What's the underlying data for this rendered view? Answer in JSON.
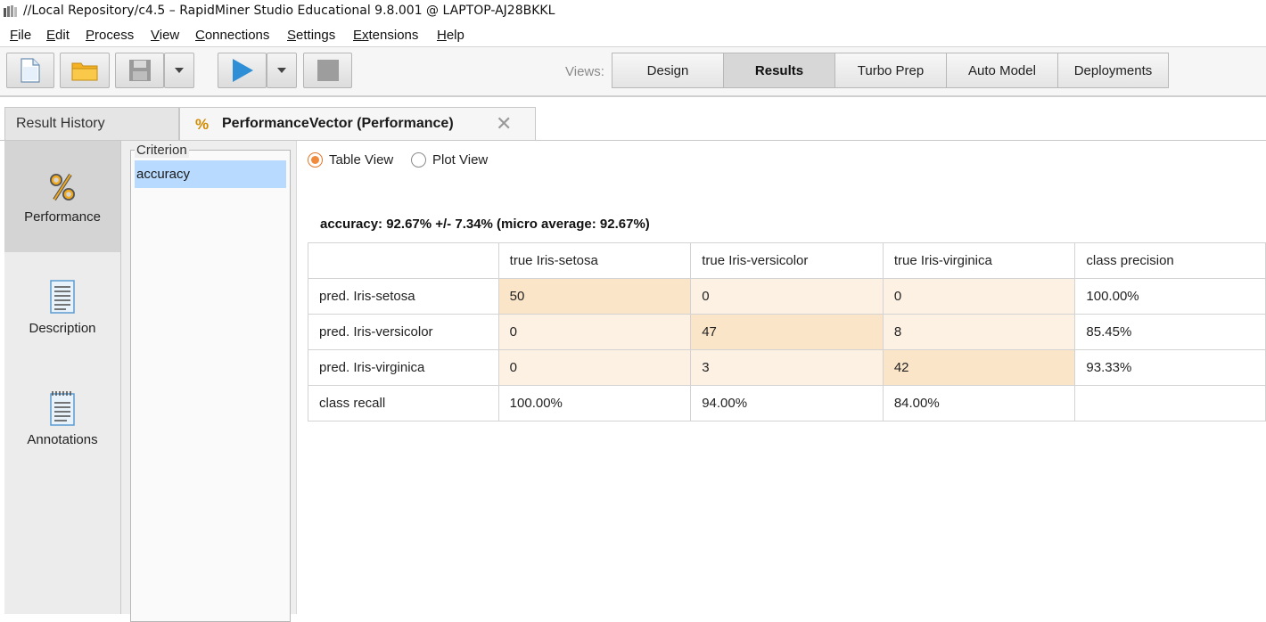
{
  "window": {
    "title": "//Local Repository/c4.5 – RapidMiner Studio Educational 9.8.001 @ LAPTOP-AJ28BKKL"
  },
  "menu": [
    {
      "mnemonic": "F",
      "rest": "ile"
    },
    {
      "mnemonic": "E",
      "rest": "dit"
    },
    {
      "mnemonic": "P",
      "rest": "rocess"
    },
    {
      "mnemonic": "V",
      "rest": "iew"
    },
    {
      "mnemonic": "C",
      "rest": "onnections"
    },
    {
      "mnemonic": "S",
      "rest": "ettings"
    },
    {
      "mnemonic": "Ex",
      "rest": "tensions"
    },
    {
      "mnemonic": "H",
      "rest": "elp"
    }
  ],
  "toolbar": {
    "icons": [
      "new-process-icon",
      "open-folder-icon",
      "save-icon",
      "dropdown-arrow-icon",
      "run-icon",
      "dropdown-arrow-icon",
      "stop-icon"
    ],
    "views_label": "Views:",
    "views": [
      "Design",
      "Results",
      "Turbo Prep",
      "Auto Model",
      "Deployments"
    ],
    "active_view": "Results"
  },
  "tabs": {
    "history": "Result History",
    "performance": "PerformanceVector (Performance)",
    "performance_icon": "%",
    "close_glyph": "✕"
  },
  "leftnav": {
    "items": [
      {
        "label": "Performance",
        "icon": "percent-icon",
        "selected": true
      },
      {
        "label": "Description",
        "icon": "description-icon",
        "selected": false
      },
      {
        "label": "Annotations",
        "icon": "annotations-icon",
        "selected": false
      }
    ]
  },
  "criterion": {
    "legend": "Criterion",
    "items": [
      "accuracy"
    ],
    "selected": "accuracy"
  },
  "view_mode": {
    "options": [
      "Table View",
      "Plot View"
    ],
    "selected": "Table View"
  },
  "accuracy_summary": "accuracy: 92.67% +/- 7.34% (micro average: 92.67%)",
  "confusion_matrix": {
    "header": [
      "",
      "true Iris-setosa",
      "true Iris-versicolor",
      "true Iris-virginica",
      "class precision"
    ],
    "rows": [
      {
        "label": "pred. Iris-setosa",
        "cells": [
          "50",
          "0",
          "0"
        ],
        "precision": "100.00%"
      },
      {
        "label": "pred. Iris-versicolor",
        "cells": [
          "0",
          "47",
          "8"
        ],
        "precision": "85.45%"
      },
      {
        "label": "pred. Iris-virginica",
        "cells": [
          "0",
          "3",
          "42"
        ],
        "precision": "93.33%"
      }
    ],
    "recall": {
      "label": "class recall",
      "cells": [
        "100.00%",
        "94.00%",
        "84.00%"
      ],
      "precision": ""
    },
    "colors": {
      "diagonal": "#fbe5c9",
      "off_diagonal": "#fdf1e3"
    }
  }
}
